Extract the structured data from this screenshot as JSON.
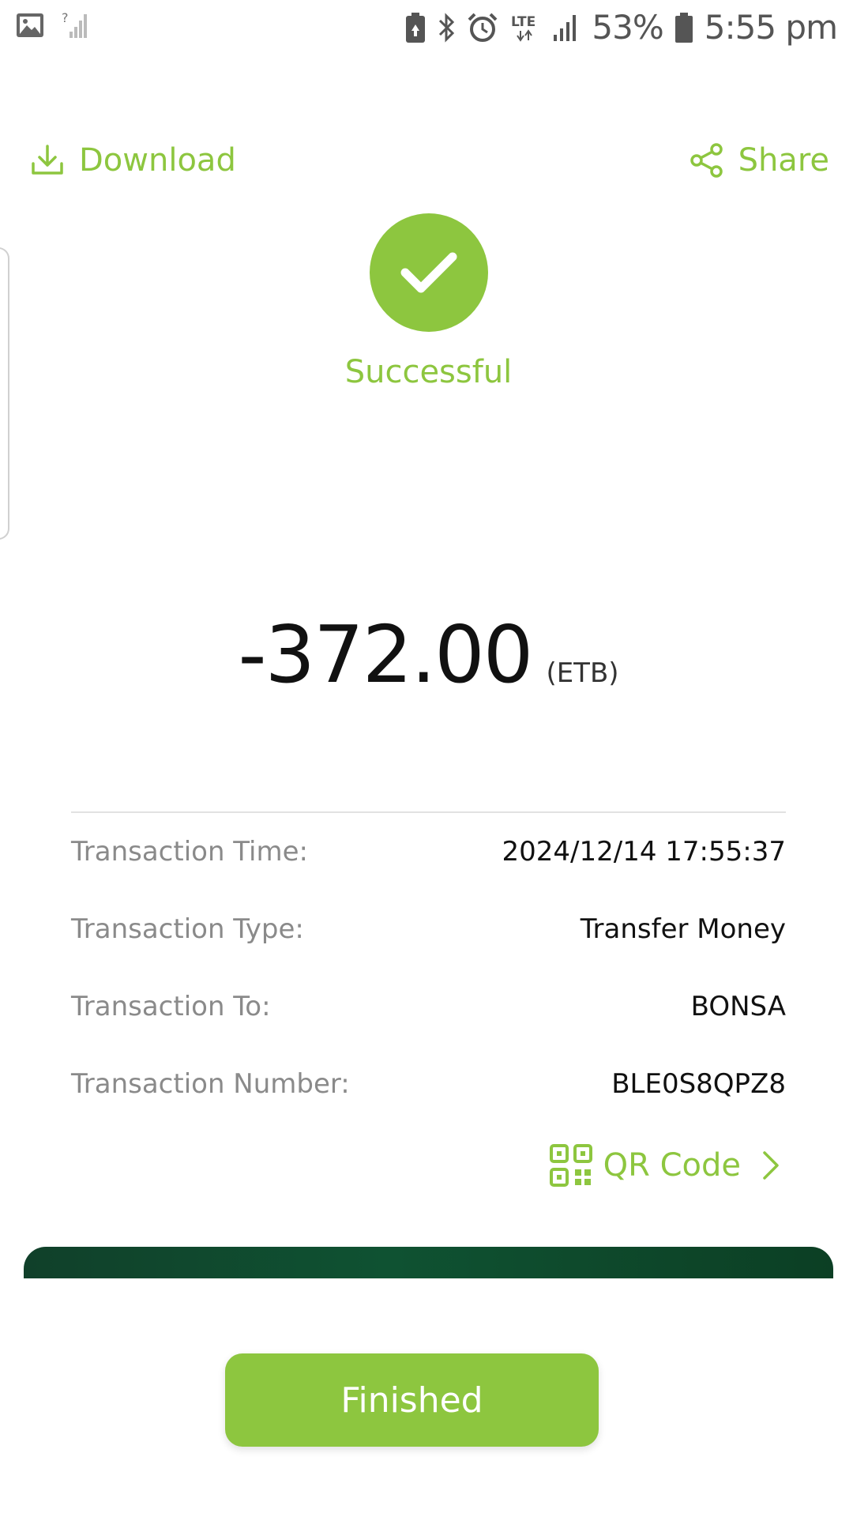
{
  "status_bar": {
    "battery": "53%",
    "time": "5:55 pm",
    "network": "LTE",
    "sim_unknown": "?"
  },
  "actions": {
    "download_label": "Download",
    "share_label": "Share"
  },
  "result": {
    "status_label": "Successful"
  },
  "amount": {
    "value": "-372.00",
    "currency": "(ETB)"
  },
  "details": [
    {
      "label": "Transaction Time:",
      "value": "2024/12/14 17:55:37"
    },
    {
      "label": "Transaction Type:",
      "value": "Transfer Money"
    },
    {
      "label": "Transaction To:",
      "value": "BONSA"
    },
    {
      "label": "Transaction Number:",
      "value": "BLE0S8QPZ8"
    }
  ],
  "qr": {
    "label": "QR Code"
  },
  "finish": {
    "label": "Finished"
  },
  "colors": {
    "accent": "#8dc63f",
    "dark_band": "#0f5232",
    "label_gray": "#8a8a8a"
  },
  "icons": {
    "status_left": [
      "gallery-icon",
      "no-signal-icon"
    ],
    "status_right": [
      "battery-saver-icon",
      "bluetooth-icon",
      "alarm-icon",
      "lte-icon",
      "signal-icon",
      "battery-icon"
    ],
    "download": "download-icon",
    "share": "share-icon",
    "success": "check-icon",
    "qr": "qr-code-icon",
    "chevron": "chevron-right-icon"
  }
}
